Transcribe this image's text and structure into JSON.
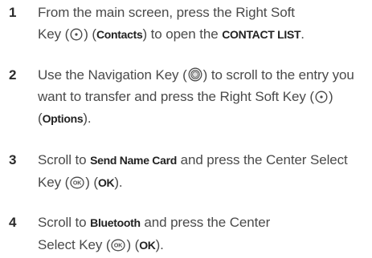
{
  "steps": [
    {
      "number": "1",
      "t1": "From the main screen, press the Right Soft Key (",
      "icon": "soft-key-icon",
      "t2": ") (",
      "b1": "Contacts",
      "t3": ") to open the ",
      "b2": "CONTACT LIST",
      "t4": "."
    },
    {
      "number": "2",
      "t1": "Use the Navigation Key (",
      "icon1": "navigation-key-icon",
      "t2": ") to scroll to the entry you want to transfer and press the Right Soft Key (",
      "icon2": "soft-key-icon",
      "t3": ") (",
      "b1": "Options",
      "t4": ")."
    },
    {
      "number": "3",
      "t1": "Scroll to ",
      "b1": "Send Name Card",
      "t2": " and press the Center Select Key (",
      "icon": "ok-key-icon",
      "t3": ") (",
      "b2": "OK",
      "t4": ")."
    },
    {
      "number": "4",
      "t1": "Scroll to ",
      "b1": "Bluetooth",
      "t2": " and press the Center Select Key (",
      "icon": "ok-key-icon",
      "t3": ") (",
      "b2": "OK",
      "t4": ")."
    }
  ]
}
